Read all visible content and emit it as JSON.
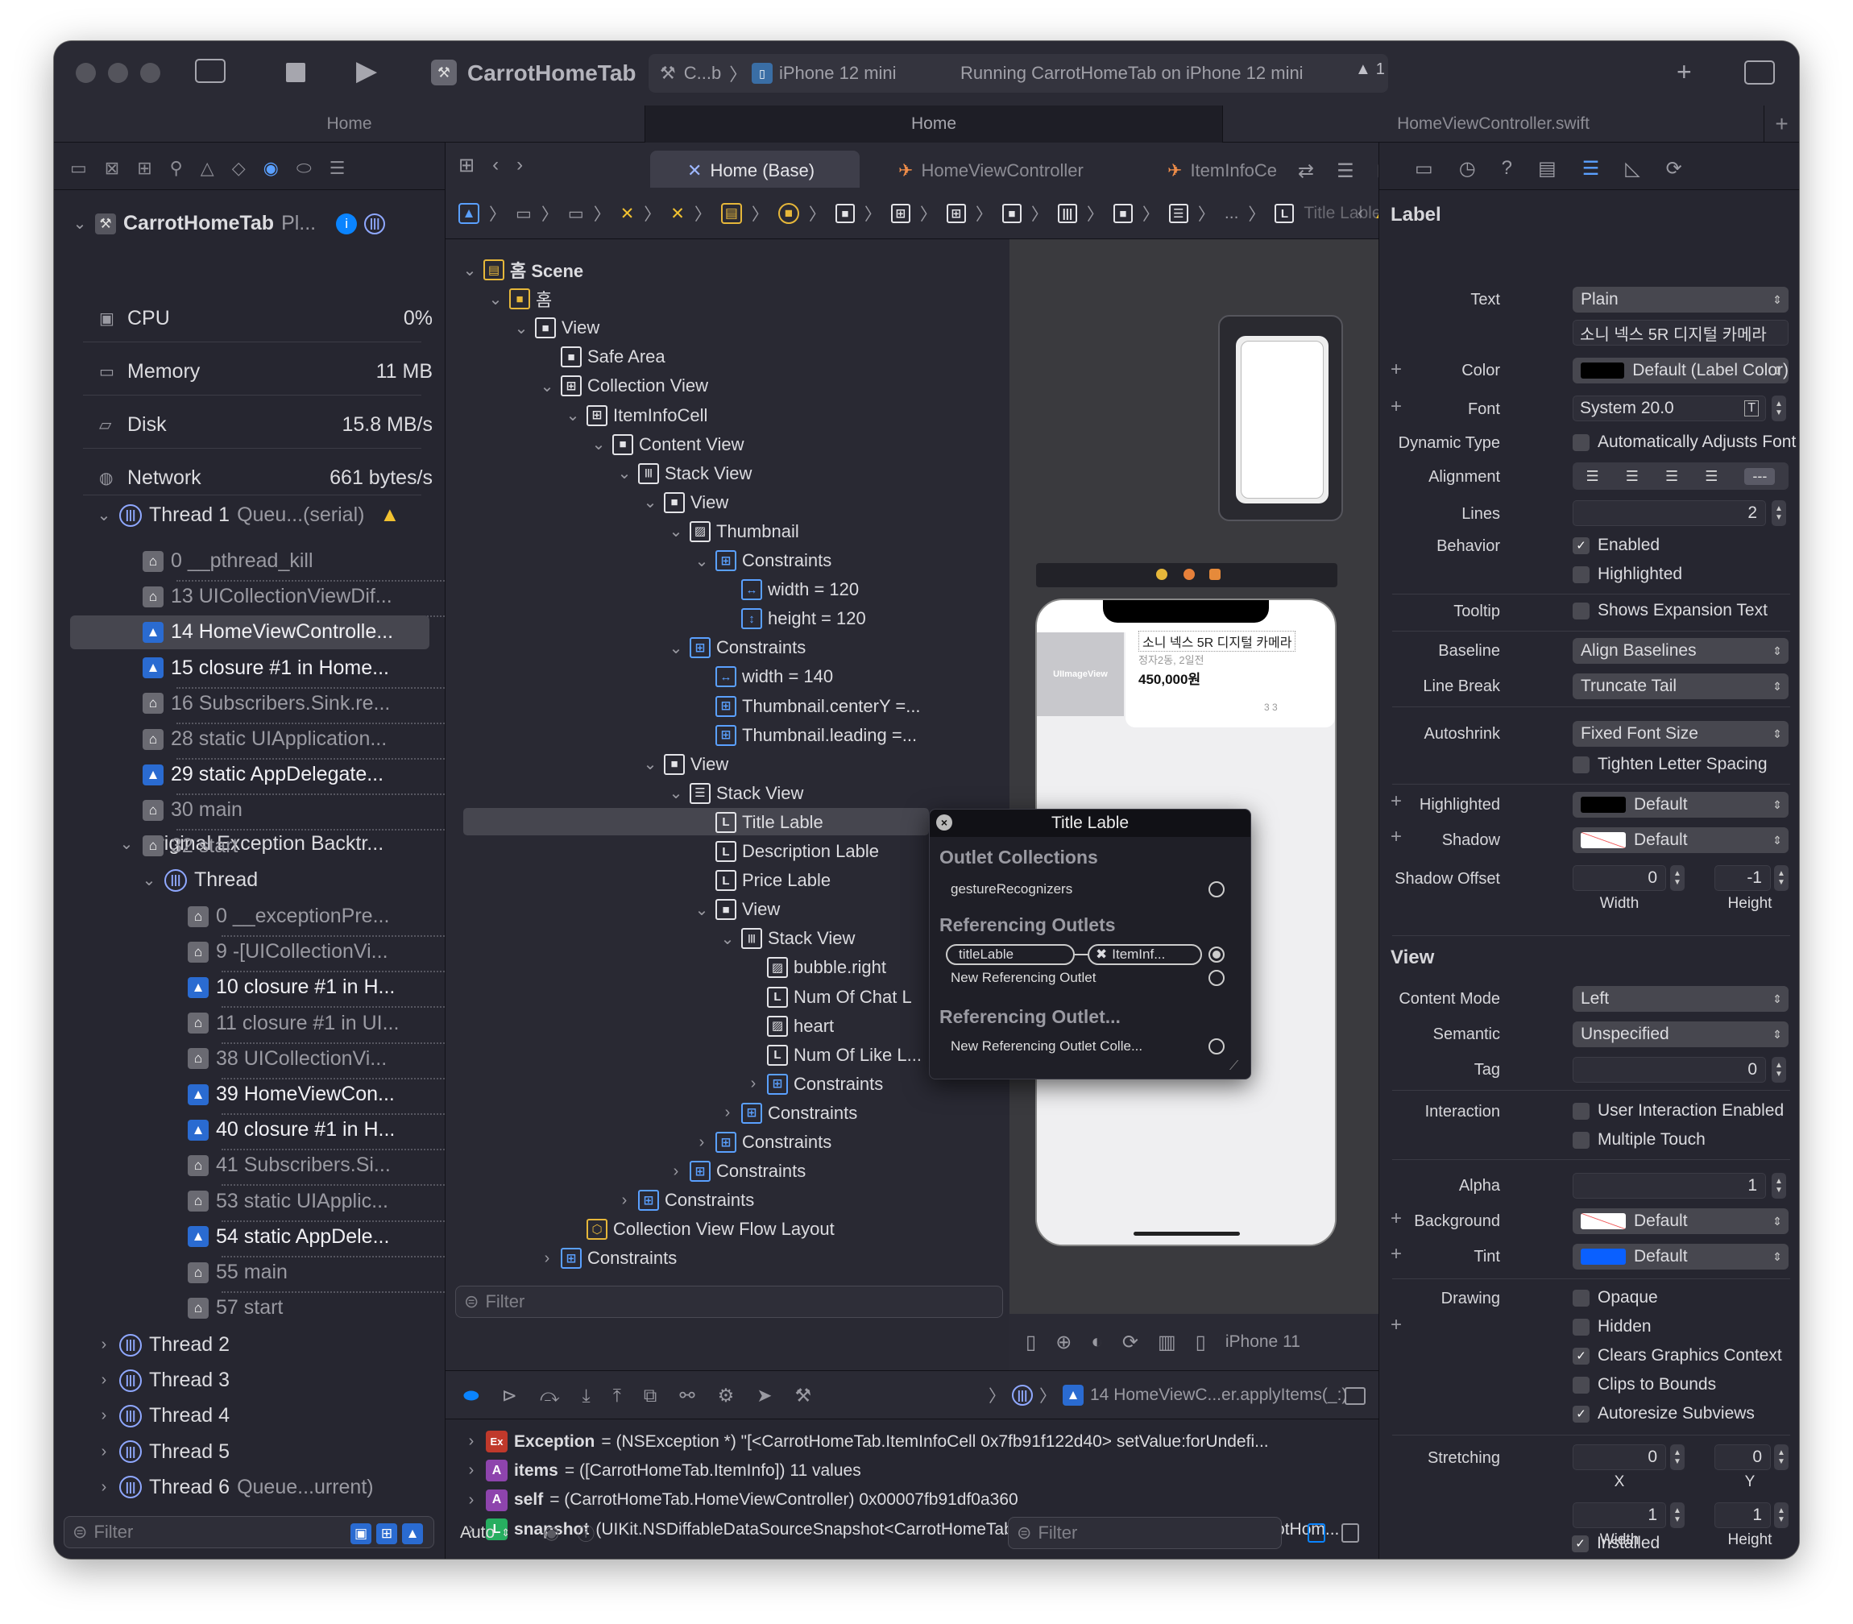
{
  "toolbar": {
    "app_title": "CarrotHomeTab",
    "scheme": "C...b",
    "device": "iPhone 12 mini",
    "status": "Running CarrotHomeTab on iPhone 12 mini",
    "warning_count": "1"
  },
  "tabs": [
    "Home",
    "Home",
    "HomeViewController.swift"
  ],
  "navigator": {
    "process_name": "CarrotHomeTab",
    "process_suffix": "Pl...",
    "gauges": [
      {
        "label": "CPU",
        "value": "0%"
      },
      {
        "label": "Memory",
        "value": "11 MB"
      },
      {
        "label": "Disk",
        "value": "15.8 MB/s"
      },
      {
        "label": "Network",
        "value": "661 bytes/s"
      }
    ],
    "thread1": {
      "label": "Thread 1",
      "suffix": "Queu...(serial)"
    },
    "thread1_frames": [
      {
        "label": "0 __pthread_kill",
        "style": "dim"
      },
      {
        "label": "13 UICollectionViewDif...",
        "style": "dim"
      },
      {
        "label": "14 HomeViewControlle...",
        "style": "selected"
      },
      {
        "label": "15 closure #1 in Home...",
        "style": "bright"
      },
      {
        "label": "16 Subscribers.Sink.re...",
        "style": "dim"
      },
      {
        "label": "28 static UIApplication...",
        "style": "dim"
      },
      {
        "label": "29 static AppDelegate...",
        "style": "bright"
      },
      {
        "label": "30 main",
        "style": "dim"
      },
      {
        "label": "32 start",
        "style": "dim"
      }
    ],
    "exception_group": "Original Exception Backtr...",
    "exception_thread": "Thread",
    "exception_frames": [
      {
        "label": "0 __exceptionPre...",
        "style": "dim"
      },
      {
        "label": "9 -[UICollectionVi...",
        "style": "dim"
      },
      {
        "label": "10 closure #1 in H...",
        "style": "bright"
      },
      {
        "label": "11 closure #1 in UI...",
        "style": "dim"
      },
      {
        "label": "38 UICollectionVi...",
        "style": "dim"
      },
      {
        "label": "39 HomeViewCon...",
        "style": "bright"
      },
      {
        "label": "40 closure #1 in H...",
        "style": "bright"
      },
      {
        "label": "41 Subscribers.Si...",
        "style": "dim"
      },
      {
        "label": "53 static UIApplic...",
        "style": "dim"
      },
      {
        "label": "54 static AppDele...",
        "style": "bright"
      },
      {
        "label": "55 main",
        "style": "dim"
      },
      {
        "label": "57 start",
        "style": "dim"
      }
    ],
    "threads": [
      {
        "label": "Thread 2",
        "suffix": ""
      },
      {
        "label": "Thread 3",
        "suffix": ""
      },
      {
        "label": "Thread 4",
        "suffix": ""
      },
      {
        "label": "Thread 5",
        "suffix": ""
      },
      {
        "label": "Thread 6",
        "suffix": "Queue...urrent)"
      }
    ],
    "filter_placeholder": "Filter"
  },
  "editor": {
    "tabs": [
      "Home (Base)",
      "HomeViewController",
      "ItemInfoCe"
    ],
    "jump_last": "Title Lable",
    "outline": [
      {
        "label": "홈 Scene",
        "icon": "scene",
        "bold": true
      },
      {
        "label": "홈",
        "icon": "vc"
      },
      {
        "label": "View",
        "icon": "view"
      },
      {
        "label": "Safe Area",
        "icon": "view"
      },
      {
        "label": "Collection View",
        "icon": "grid"
      },
      {
        "label": "ItemInfoCell",
        "icon": "grid"
      },
      {
        "label": "Content View",
        "icon": "view"
      },
      {
        "label": "Stack View",
        "icon": "hstack"
      },
      {
        "label": "View",
        "icon": "view"
      },
      {
        "label": "Thumbnail",
        "icon": "image"
      },
      {
        "label": "Constraints",
        "icon": "constraints"
      },
      {
        "label": "width = 120",
        "icon": "width"
      },
      {
        "label": "height = 120",
        "icon": "height"
      },
      {
        "label": "Constraints",
        "icon": "constraints"
      },
      {
        "label": "width = 140",
        "icon": "width"
      },
      {
        "label": "Thumbnail.centerY =...",
        "icon": "constraint"
      },
      {
        "label": "Thumbnail.leading =...",
        "icon": "constraint"
      },
      {
        "label": "View",
        "icon": "view"
      },
      {
        "label": "Stack View",
        "icon": "vstack"
      },
      {
        "label": "Title Lable",
        "icon": "label"
      },
      {
        "label": "Description Lable",
        "icon": "label"
      },
      {
        "label": "Price Lable",
        "icon": "label"
      },
      {
        "label": "View",
        "icon": "view"
      },
      {
        "label": "Stack View",
        "icon": "hstack"
      },
      {
        "label": "bubble.right",
        "icon": "image"
      },
      {
        "label": "Num Of Chat L",
        "icon": "label"
      },
      {
        "label": "heart",
        "icon": "image"
      },
      {
        "label": "Num Of Like L...",
        "icon": "label"
      },
      {
        "label": "Constraints",
        "icon": "constraints"
      },
      {
        "label": "Constraints",
        "icon": "constraints"
      },
      {
        "label": "Constraints",
        "icon": "constraints"
      },
      {
        "label": "Constraints",
        "icon": "constraints"
      },
      {
        "label": "Constraints",
        "icon": "constraints"
      },
      {
        "label": "Collection View Flow Layout",
        "icon": "layout"
      },
      {
        "label": "Constraints",
        "icon": "constraints"
      }
    ],
    "filter_placeholder": "Filter",
    "device_config": "iPhone 11"
  },
  "canvas": {
    "cell_title": "소니 넥스 5R 디지털 카메라",
    "cell_location": "정자2동, 2일전",
    "cell_price": "450,000원",
    "cell_counts": "3  3",
    "thumbnail_text": "UIImageView"
  },
  "popup": {
    "title": "Title Lable",
    "section1": "Outlet Collections",
    "outlet_collection": "gestureRecognizers",
    "section2": "Referencing Outlets",
    "outlet_name": "titleLable",
    "outlet_target": "ItemInf...",
    "new_outlet": "New Referencing Outlet",
    "section3": "Referencing Outlet...",
    "new_collection": "New Referencing Outlet Colle..."
  },
  "inspector": {
    "section_label": "Label",
    "text_label": "Text",
    "text_value": "Plain",
    "text_content": "소니 넥스 5R 디지털 카메라",
    "color_label": "Color",
    "color_value": "Default (Label Color)",
    "font_label": "Font",
    "font_value": "System 20.0",
    "dynamic_type_label": "Dynamic Type",
    "dynamic_type_value": "Automatically Adjusts Font",
    "alignment_label": "Alignment",
    "lines_label": "Lines",
    "lines_value": "2",
    "behavior_label": "Behavior",
    "enabled": "Enabled",
    "highlighted": "Highlighted",
    "tooltip_label": "Tooltip",
    "tooltip_value": "Shows Expansion Text",
    "baseline_label": "Baseline",
    "baseline_value": "Align Baselines",
    "linebreak_label": "Line Break",
    "linebreak_value": "Truncate Tail",
    "autoshrink_label": "Autoshrink",
    "autoshrink_value": "Fixed Font Size",
    "tighten": "Tighten Letter Spacing",
    "highlighted_label": "Highlighted",
    "highlighted_value": "Default",
    "shadow_label": "Shadow",
    "shadow_value": "Default",
    "shadow_offset_label": "Shadow Offset",
    "shadow_w": "0",
    "shadow_h": "-1",
    "width_caption": "Width",
    "height_caption": "Height",
    "view_section": "View",
    "content_mode_label": "Content Mode",
    "content_mode_value": "Left",
    "semantic_label": "Semantic",
    "semantic_value": "Unspecified",
    "tag_label": "Tag",
    "tag_value": "0",
    "interaction_label": "Interaction",
    "user_interaction": "User Interaction Enabled",
    "multiple_touch": "Multiple Touch",
    "alpha_label": "Alpha",
    "alpha_value": "1",
    "background_label": "Background",
    "background_value": "Default",
    "tint_label": "Tint",
    "tint_value": "Default",
    "drawing_label": "Drawing",
    "opaque": "Opaque",
    "hidden": "Hidden",
    "clears": "Clears Graphics Context",
    "clips": "Clips to Bounds",
    "autoresize": "Autoresize Subviews",
    "stretching_label": "Stretching",
    "stretch_x": "0",
    "stretch_y": "0",
    "stretch_w": "1",
    "stretch_h": "1",
    "x_caption": "X",
    "y_caption": "Y",
    "installed": "Installed"
  },
  "debug": {
    "frame_path": "14 HomeViewC...er.applyItems(_:)",
    "vars": [
      {
        "badge": "Ex",
        "color": "#c0392b",
        "name": "Exception",
        "value": "= (NSException *) \"[<CarrotHomeTab.ItemInfoCell 0x7fb91f122d40> setValue:forUndefi..."
      },
      {
        "badge": "A",
        "color": "#8e44ad",
        "name": "items",
        "value": "= ([CarrotHomeTab.ItemInfo]) 11 values"
      },
      {
        "badge": "A",
        "color": "#8e44ad",
        "name": "self",
        "value": "= (CarrotHomeTab.HomeViewController) 0x00007fb91df0a360"
      },
      {
        "badge": "L",
        "color": "#27ae60",
        "name": "snapshot",
        "value": "(UIKit.NSDiffableDataSourceSnapshot<CarrotHomeTab.HomeViewController.Section, CarrotHom..."
      }
    ],
    "auto_label": "Auto",
    "filter_placeholder": "Filter"
  },
  "colors": {
    "accent": "#0a84ff",
    "selected_row": "#46464f",
    "warning": "#f2c230"
  }
}
